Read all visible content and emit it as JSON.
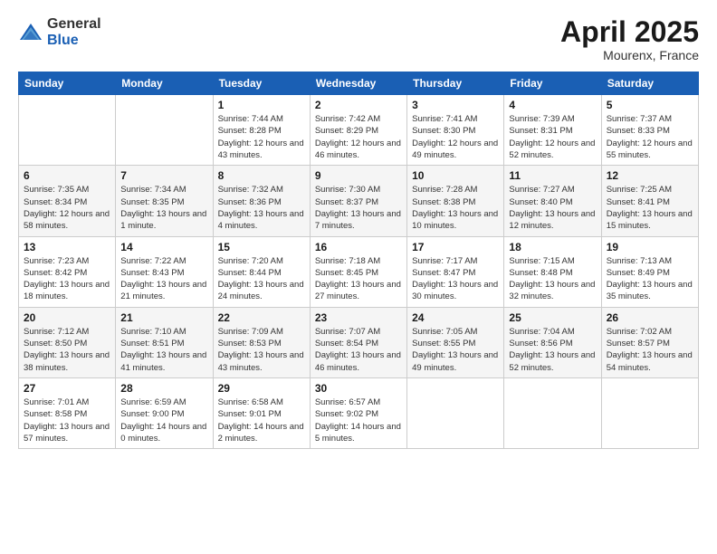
{
  "logo": {
    "general": "General",
    "blue": "Blue"
  },
  "title": {
    "month": "April 2025",
    "location": "Mourenx, France"
  },
  "headers": [
    "Sunday",
    "Monday",
    "Tuesday",
    "Wednesday",
    "Thursday",
    "Friday",
    "Saturday"
  ],
  "weeks": [
    [
      {
        "day": "",
        "info": ""
      },
      {
        "day": "",
        "info": ""
      },
      {
        "day": "1",
        "info": "Sunrise: 7:44 AM\nSunset: 8:28 PM\nDaylight: 12 hours and 43 minutes."
      },
      {
        "day": "2",
        "info": "Sunrise: 7:42 AM\nSunset: 8:29 PM\nDaylight: 12 hours and 46 minutes."
      },
      {
        "day": "3",
        "info": "Sunrise: 7:41 AM\nSunset: 8:30 PM\nDaylight: 12 hours and 49 minutes."
      },
      {
        "day": "4",
        "info": "Sunrise: 7:39 AM\nSunset: 8:31 PM\nDaylight: 12 hours and 52 minutes."
      },
      {
        "day": "5",
        "info": "Sunrise: 7:37 AM\nSunset: 8:33 PM\nDaylight: 12 hours and 55 minutes."
      }
    ],
    [
      {
        "day": "6",
        "info": "Sunrise: 7:35 AM\nSunset: 8:34 PM\nDaylight: 12 hours and 58 minutes."
      },
      {
        "day": "7",
        "info": "Sunrise: 7:34 AM\nSunset: 8:35 PM\nDaylight: 13 hours and 1 minute."
      },
      {
        "day": "8",
        "info": "Sunrise: 7:32 AM\nSunset: 8:36 PM\nDaylight: 13 hours and 4 minutes."
      },
      {
        "day": "9",
        "info": "Sunrise: 7:30 AM\nSunset: 8:37 PM\nDaylight: 13 hours and 7 minutes."
      },
      {
        "day": "10",
        "info": "Sunrise: 7:28 AM\nSunset: 8:38 PM\nDaylight: 13 hours and 10 minutes."
      },
      {
        "day": "11",
        "info": "Sunrise: 7:27 AM\nSunset: 8:40 PM\nDaylight: 13 hours and 12 minutes."
      },
      {
        "day": "12",
        "info": "Sunrise: 7:25 AM\nSunset: 8:41 PM\nDaylight: 13 hours and 15 minutes."
      }
    ],
    [
      {
        "day": "13",
        "info": "Sunrise: 7:23 AM\nSunset: 8:42 PM\nDaylight: 13 hours and 18 minutes."
      },
      {
        "day": "14",
        "info": "Sunrise: 7:22 AM\nSunset: 8:43 PM\nDaylight: 13 hours and 21 minutes."
      },
      {
        "day": "15",
        "info": "Sunrise: 7:20 AM\nSunset: 8:44 PM\nDaylight: 13 hours and 24 minutes."
      },
      {
        "day": "16",
        "info": "Sunrise: 7:18 AM\nSunset: 8:45 PM\nDaylight: 13 hours and 27 minutes."
      },
      {
        "day": "17",
        "info": "Sunrise: 7:17 AM\nSunset: 8:47 PM\nDaylight: 13 hours and 30 minutes."
      },
      {
        "day": "18",
        "info": "Sunrise: 7:15 AM\nSunset: 8:48 PM\nDaylight: 13 hours and 32 minutes."
      },
      {
        "day": "19",
        "info": "Sunrise: 7:13 AM\nSunset: 8:49 PM\nDaylight: 13 hours and 35 minutes."
      }
    ],
    [
      {
        "day": "20",
        "info": "Sunrise: 7:12 AM\nSunset: 8:50 PM\nDaylight: 13 hours and 38 minutes."
      },
      {
        "day": "21",
        "info": "Sunrise: 7:10 AM\nSunset: 8:51 PM\nDaylight: 13 hours and 41 minutes."
      },
      {
        "day": "22",
        "info": "Sunrise: 7:09 AM\nSunset: 8:53 PM\nDaylight: 13 hours and 43 minutes."
      },
      {
        "day": "23",
        "info": "Sunrise: 7:07 AM\nSunset: 8:54 PM\nDaylight: 13 hours and 46 minutes."
      },
      {
        "day": "24",
        "info": "Sunrise: 7:05 AM\nSunset: 8:55 PM\nDaylight: 13 hours and 49 minutes."
      },
      {
        "day": "25",
        "info": "Sunrise: 7:04 AM\nSunset: 8:56 PM\nDaylight: 13 hours and 52 minutes."
      },
      {
        "day": "26",
        "info": "Sunrise: 7:02 AM\nSunset: 8:57 PM\nDaylight: 13 hours and 54 minutes."
      }
    ],
    [
      {
        "day": "27",
        "info": "Sunrise: 7:01 AM\nSunset: 8:58 PM\nDaylight: 13 hours and 57 minutes."
      },
      {
        "day": "28",
        "info": "Sunrise: 6:59 AM\nSunset: 9:00 PM\nDaylight: 14 hours and 0 minutes."
      },
      {
        "day": "29",
        "info": "Sunrise: 6:58 AM\nSunset: 9:01 PM\nDaylight: 14 hours and 2 minutes."
      },
      {
        "day": "30",
        "info": "Sunrise: 6:57 AM\nSunset: 9:02 PM\nDaylight: 14 hours and 5 minutes."
      },
      {
        "day": "",
        "info": ""
      },
      {
        "day": "",
        "info": ""
      },
      {
        "day": "",
        "info": ""
      }
    ]
  ]
}
